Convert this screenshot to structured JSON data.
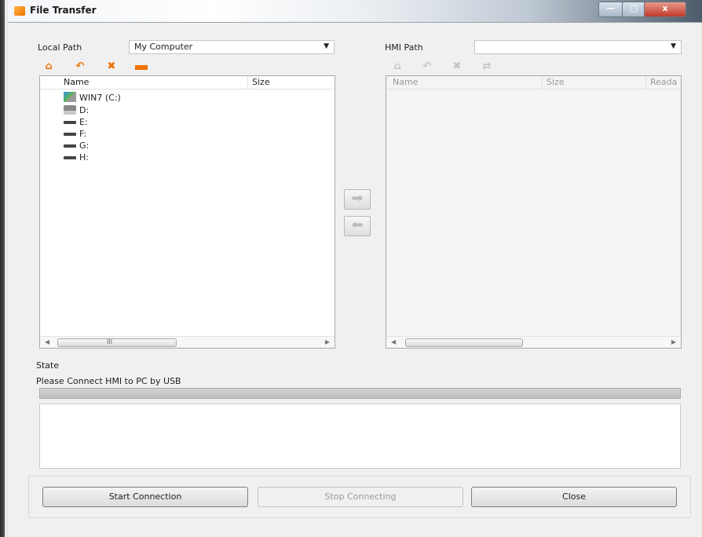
{
  "window": {
    "title": "File Transfer",
    "controls": {
      "minimize": "—",
      "maximize": "□",
      "close": "x"
    }
  },
  "local": {
    "path_label": "Local Path",
    "path_value": "My Computer",
    "toolbar_icons": [
      "home-icon",
      "back-icon",
      "delete-icon",
      "folder-icon"
    ],
    "columns": [
      "Name",
      "Size"
    ],
    "items": [
      {
        "name": "WIN7 (C:)",
        "icon": "system-drive-icon"
      },
      {
        "name": "D:",
        "icon": "cd-drive-icon"
      },
      {
        "name": "E:",
        "icon": "hard-drive-icon"
      },
      {
        "name": "F:",
        "icon": "hard-drive-icon"
      },
      {
        "name": "G:",
        "icon": "hard-drive-icon"
      },
      {
        "name": "H:",
        "icon": "hard-drive-icon"
      }
    ],
    "scroll_label": "III"
  },
  "hmi": {
    "path_label": "HMI Path",
    "path_value": "",
    "toolbar_icons": [
      "home-icon",
      "back-icon",
      "delete-icon",
      "refresh-icon"
    ],
    "columns": [
      "Name",
      "Size",
      "Reada"
    ]
  },
  "transfer": {
    "to_hmi_icon": "arrow-right-icon",
    "to_local_icon": "arrow-left-icon"
  },
  "state": {
    "label": "State",
    "message": "Please Connect HMI to PC by USB",
    "progress": 0
  },
  "buttons": {
    "start": "Start Connection",
    "stop": "Stop Connecting",
    "close": "Close"
  },
  "colors": {
    "accent_orange": "#f07400",
    "disabled_text": "#9a9a9a"
  }
}
